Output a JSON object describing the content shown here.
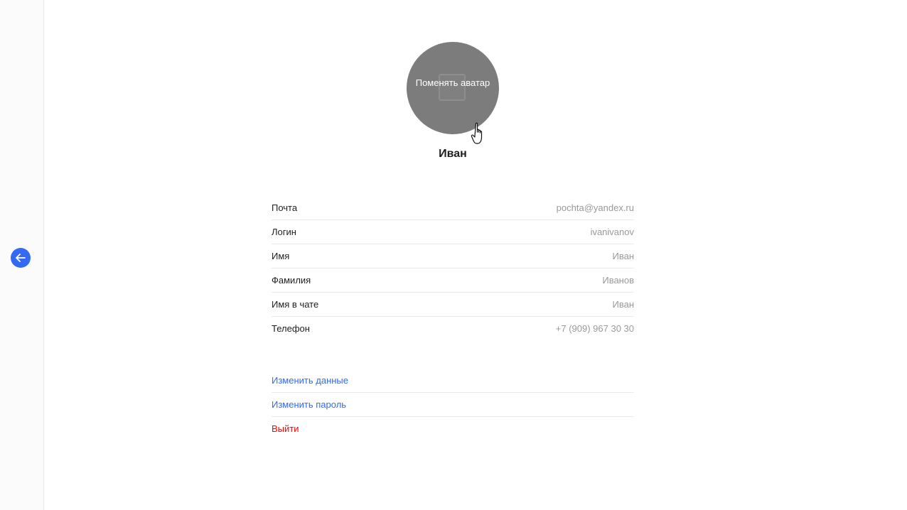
{
  "avatar": {
    "change_label": "Поменять аватар"
  },
  "profile": {
    "display_name": "Иван"
  },
  "fields": [
    {
      "label": "Почта",
      "value": "pochta@yandex.ru"
    },
    {
      "label": "Логин",
      "value": "ivanivanov"
    },
    {
      "label": "Имя",
      "value": "Иван"
    },
    {
      "label": "Фамилия",
      "value": "Иванов"
    },
    {
      "label": "Имя в чате",
      "value": "Иван"
    },
    {
      "label": "Телефон",
      "value": "+7 (909) 967 30 30"
    }
  ],
  "actions": {
    "edit_data": "Изменить данные",
    "edit_password": "Изменить пароль",
    "logout": "Выйти"
  },
  "colors": {
    "accent": "#3369f3",
    "danger": "#ff0000",
    "avatar_bg": "#7c7c7c",
    "muted_text": "#999999"
  },
  "icons": {
    "back": "arrow-left-icon",
    "cursor": "hand-pointer-icon"
  }
}
